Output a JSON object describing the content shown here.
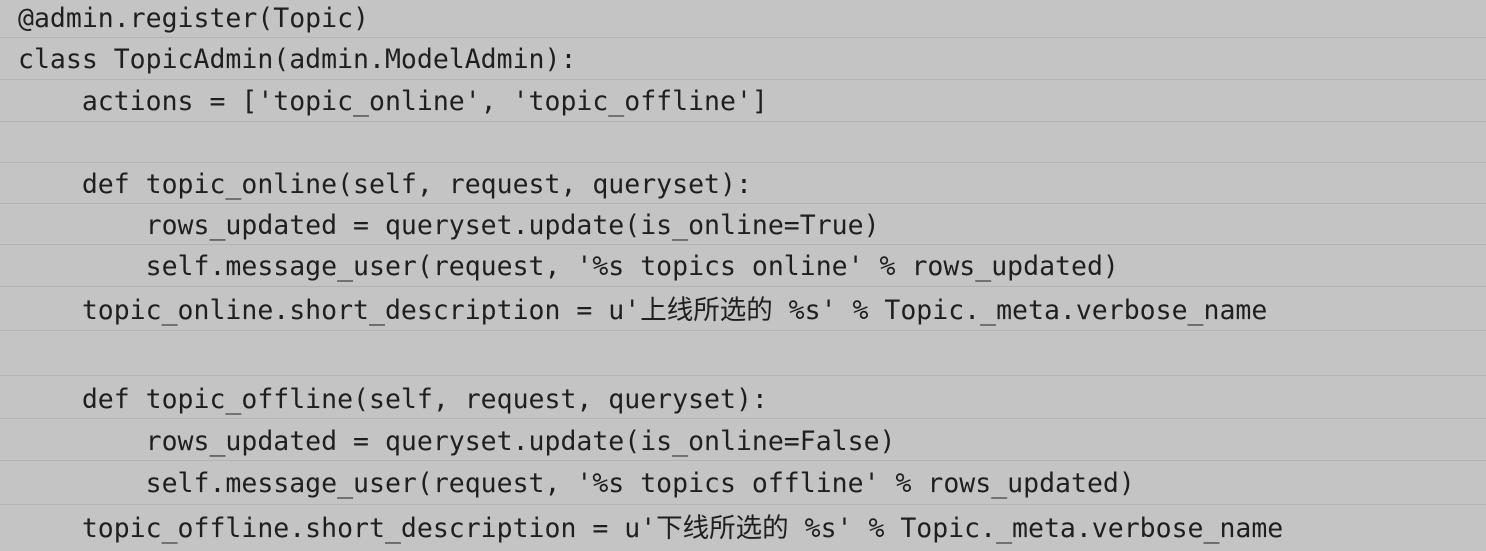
{
  "code": {
    "lines": [
      "@admin.register(Topic)",
      "class TopicAdmin(admin.ModelAdmin):",
      "    actions = ['topic_online', 'topic_offline']",
      "",
      "    def topic_online(self, request, queryset):",
      "        rows_updated = queryset.update(is_online=True)",
      "        self.message_user(request, '%s topics online' % rows_updated)",
      "    topic_online.short_description = u'上线所选的 %s' % Topic._meta.verbose_name",
      "",
      "    def topic_offline(self, request, queryset):",
      "        rows_updated = queryset.update(is_online=False)",
      "        self.message_user(request, '%s topics offline' % rows_updated)",
      "    topic_offline.short_description = u'下线所选的 %s' % Topic._meta.verbose_name"
    ]
  }
}
